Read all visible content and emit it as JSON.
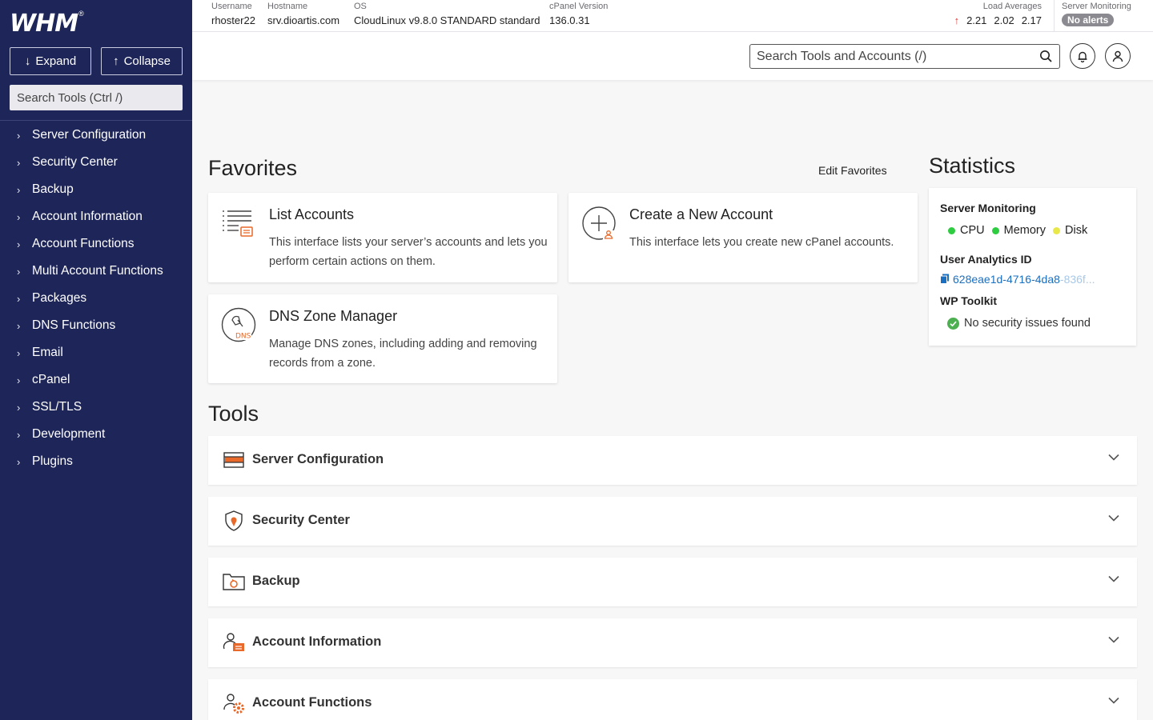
{
  "sidebar": {
    "logo": "WHM",
    "expand_label": "Expand",
    "collapse_label": "Collapse",
    "search_placeholder": "Search Tools (Ctrl /)",
    "items": [
      {
        "label": "Server Configuration"
      },
      {
        "label": "Security Center"
      },
      {
        "label": "Backup"
      },
      {
        "label": "Account Information"
      },
      {
        "label": "Account Functions"
      },
      {
        "label": "Multi Account Functions"
      },
      {
        "label": "Packages"
      },
      {
        "label": "DNS Functions"
      },
      {
        "label": "Email"
      },
      {
        "label": "cPanel"
      },
      {
        "label": "SSL/TLS"
      },
      {
        "label": "Development"
      },
      {
        "label": "Plugins"
      }
    ]
  },
  "header": {
    "username_label": "Username",
    "username": "rhoster22",
    "hostname_label": "Hostname",
    "hostname": "srv.dioartis.com",
    "os_label": "OS",
    "os": "CloudLinux v9.8.0 STANDARD standard",
    "cpanel_label": "cPanel Version",
    "cpanel": "136.0.31",
    "load_label": "Load Averages",
    "load": [
      "2.21",
      "2.02",
      "2.17"
    ],
    "monitoring_label": "Server Monitoring",
    "monitoring_badge": "No alerts"
  },
  "topbar": {
    "search_placeholder": "Search Tools and Accounts (/)"
  },
  "favorites": {
    "heading": "Favorites",
    "edit_label": "Edit Favorites",
    "cards": [
      {
        "title": "List Accounts",
        "desc": "This interface lists your server’s accounts and lets you perform certain actions on them.",
        "icon": "list-accounts-icon"
      },
      {
        "title": "Create a New Account",
        "desc": "This interface lets you create new cPanel accounts.",
        "icon": "create-account-icon"
      },
      {
        "title": "DNS Zone Manager",
        "desc": "Manage DNS zones, including adding and removing records from a zone.",
        "icon": "dns-icon"
      }
    ]
  },
  "statistics": {
    "heading": "Statistics",
    "monitoring_title": "Server Monitoring",
    "cpu": "CPU",
    "memory": "Memory",
    "disk": "Disk",
    "analytics_title": "User Analytics ID",
    "analytics_id": "628eae1d-4716-4da8",
    "analytics_id_fade": "-836f...",
    "wp_title": "WP Toolkit",
    "wp_status": "No security issues found",
    "colors": {
      "cpu": "#2ecc40",
      "memory": "#2ecc40",
      "disk": "#e8e84a",
      "ok": "#4caf50"
    }
  },
  "tools": {
    "heading": "Tools",
    "items": [
      {
        "label": "Server Configuration",
        "icon": "server-config-icon"
      },
      {
        "label": "Security Center",
        "icon": "shield-icon"
      },
      {
        "label": "Backup",
        "icon": "backup-icon"
      },
      {
        "label": "Account Information",
        "icon": "account-info-icon"
      },
      {
        "label": "Account Functions",
        "icon": "account-functions-icon"
      }
    ]
  },
  "colors": {
    "sidebar_bg": "#1d2559",
    "accent_orange": "#e8692a",
    "link_blue": "#1a6fc0"
  }
}
